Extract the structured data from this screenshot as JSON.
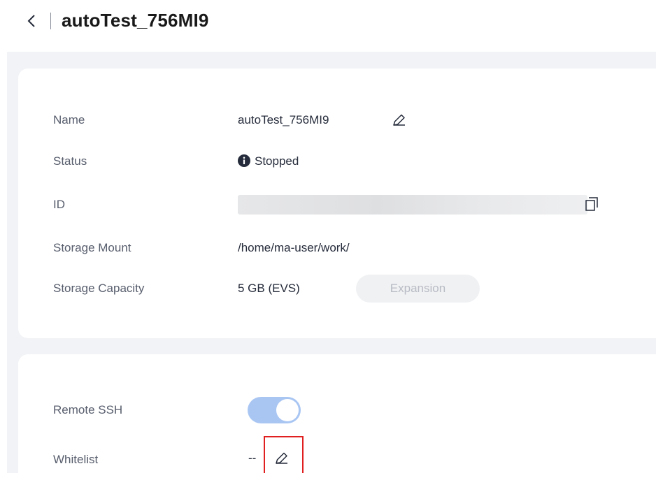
{
  "header": {
    "title": "autoTest_756MI9"
  },
  "details": {
    "name_label": "Name",
    "name_value": "autoTest_756MI9",
    "status_label": "Status",
    "status_value": "Stopped",
    "id_label": "ID",
    "storage_mount_label": "Storage Mount",
    "storage_mount_value": "/home/ma-user/work/",
    "storage_capacity_label": "Storage Capacity",
    "storage_capacity_value": "5 GB (EVS)",
    "expansion_label": "Expansion"
  },
  "remote": {
    "ssh_label": "Remote SSH",
    "ssh_enabled": true,
    "whitelist_label": "Whitelist",
    "whitelist_value": "--"
  },
  "colors": {
    "toggle_on": "#a9c6f3",
    "highlight": "#e02020",
    "status_icon": "#252b3a"
  },
  "icons": [
    "back-chevron-icon",
    "edit-pencil-icon",
    "info-circle-icon",
    "copy-icon"
  ]
}
